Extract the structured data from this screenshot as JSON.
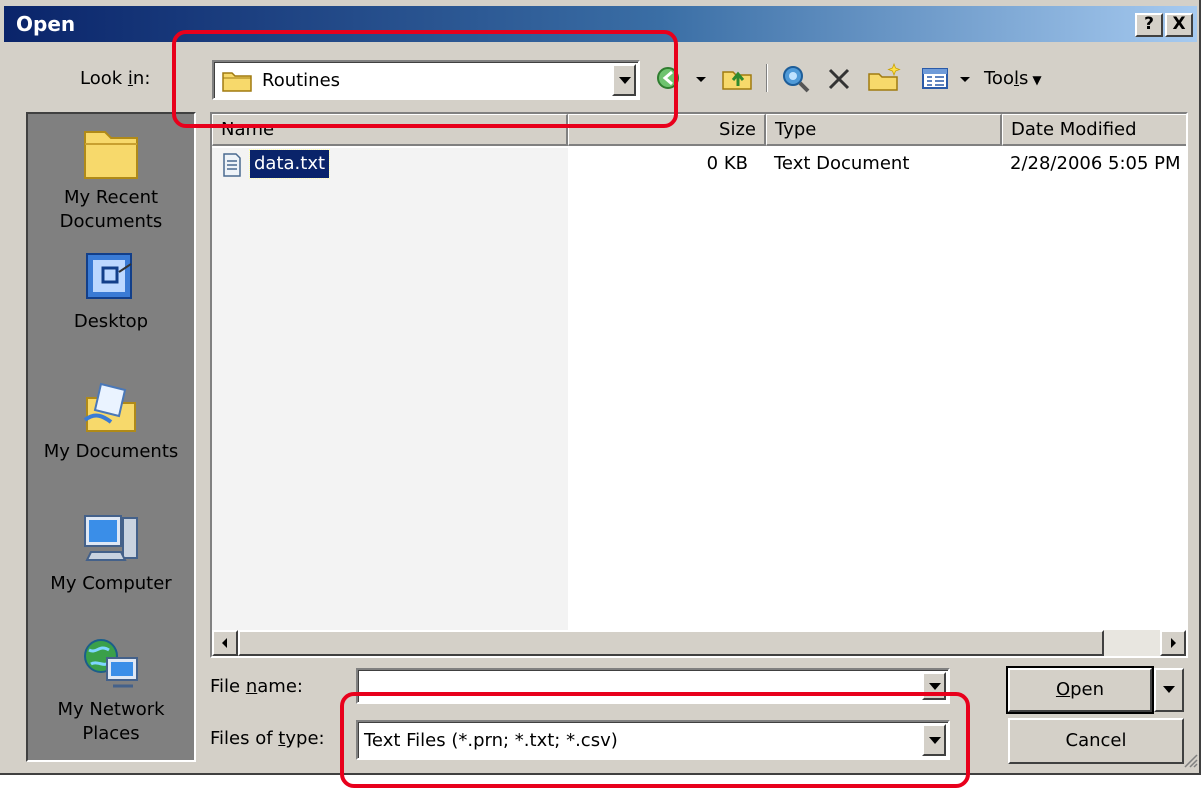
{
  "window": {
    "title": "Open",
    "help_glyph": "?",
    "close_glyph": "X"
  },
  "lookin": {
    "label_pre": "Look ",
    "label_key": "i",
    "label_post": "n:",
    "value": "Routines"
  },
  "toolbar": {
    "tools_pre": "Too",
    "tools_key": "l",
    "tools_post": "s"
  },
  "places": [
    {
      "label": "My Recent\nDocuments",
      "icon": "folder-icon"
    },
    {
      "label": "Desktop",
      "icon": "desktop-icon"
    },
    {
      "label": "My Documents",
      "icon": "my-documents-icon"
    },
    {
      "label": "My Computer",
      "icon": "computer-icon"
    },
    {
      "label": "My Network\nPlaces",
      "icon": "network-icon"
    }
  ],
  "filelist": {
    "columns": {
      "name": "Name",
      "size": "Size",
      "type": "Type",
      "date": "Date Modified"
    },
    "rows": [
      {
        "name": "data.txt",
        "size": "0 KB",
        "type": "Text Document",
        "date": "2/28/2006 5:05 PM"
      }
    ]
  },
  "filename": {
    "label_pre": "File ",
    "label_key": "n",
    "label_post": "ame:",
    "value": ""
  },
  "filetype": {
    "label_pre": "Files of ",
    "label_key": "t",
    "label_post": "ype:",
    "value": "Text Files (*.prn; *.txt; *.csv)"
  },
  "buttons": {
    "open_key": "O",
    "open_rest": "pen",
    "cancel": "Cancel"
  },
  "colors": {
    "titlebar": "#0a246a",
    "face": "#d4d0c8",
    "selection": "#0a246a",
    "highlight": "#e8001c"
  }
}
